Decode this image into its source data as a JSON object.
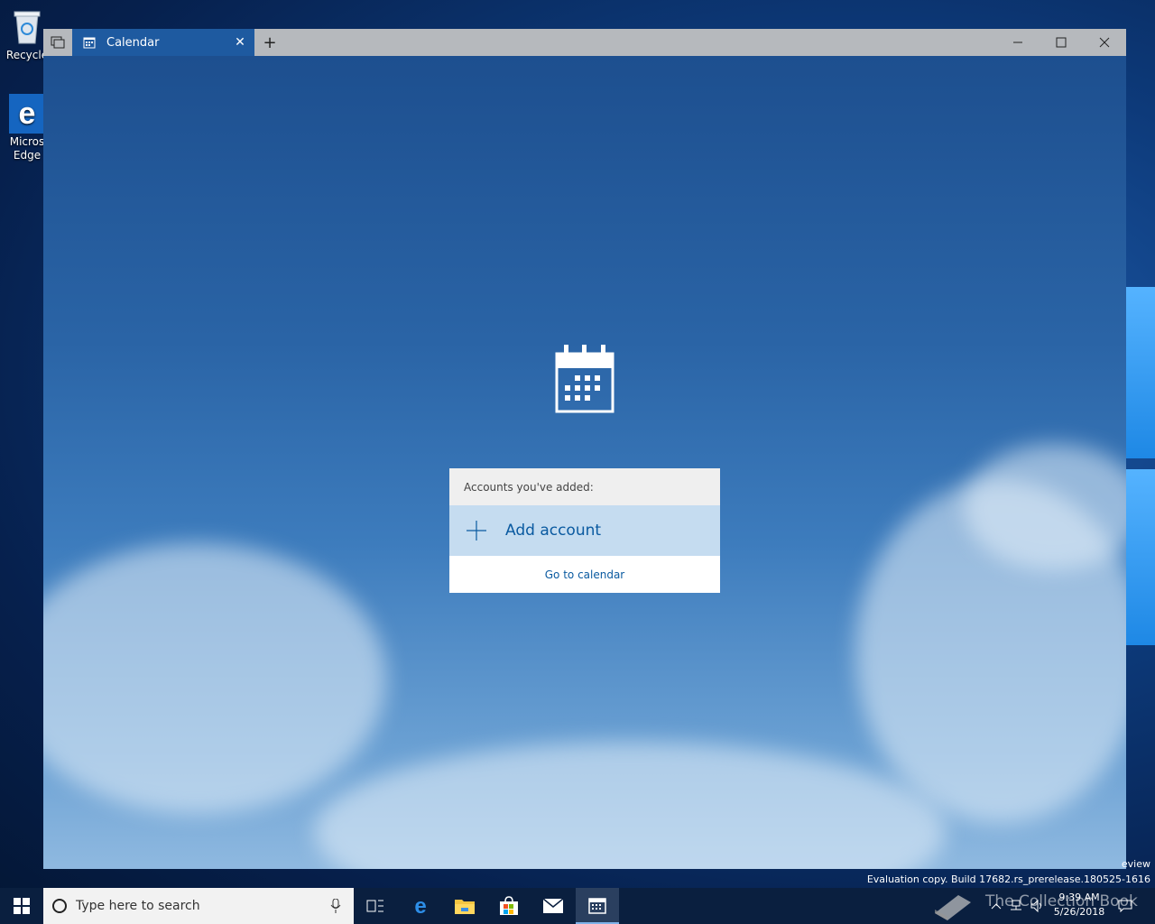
{
  "desktop": {
    "icons": [
      {
        "label_line1": "Recycle",
        "label_line2": "",
        "icon": "recycle-bin-icon"
      },
      {
        "label_line1": "Micros",
        "label_line2": "Edge",
        "icon": "edge-icon"
      }
    ]
  },
  "window": {
    "tab_title": "Calendar",
    "tab_icon": "calendar-icon",
    "new_tab_label": "+",
    "accent": "#1e5aa0"
  },
  "accounts_panel": {
    "heading": "Accounts you've added:",
    "add_account_label": "Add account",
    "go_to_calendar_label": "Go to calendar"
  },
  "watermark": {
    "line1": "eview",
    "line2": "Evaluation copy. Build 17682.rs_prerelease.180525-1616"
  },
  "taskbar": {
    "search_placeholder": "Type here to search",
    "apps": [
      "task-view-icon",
      "edge-icon",
      "file-explorer-icon",
      "store-icon",
      "mail-icon",
      "calendar-icon"
    ],
    "watermark_text": "The Collection Book",
    "clock_time": "9:39 AM",
    "clock_date": "5/26/2018"
  }
}
